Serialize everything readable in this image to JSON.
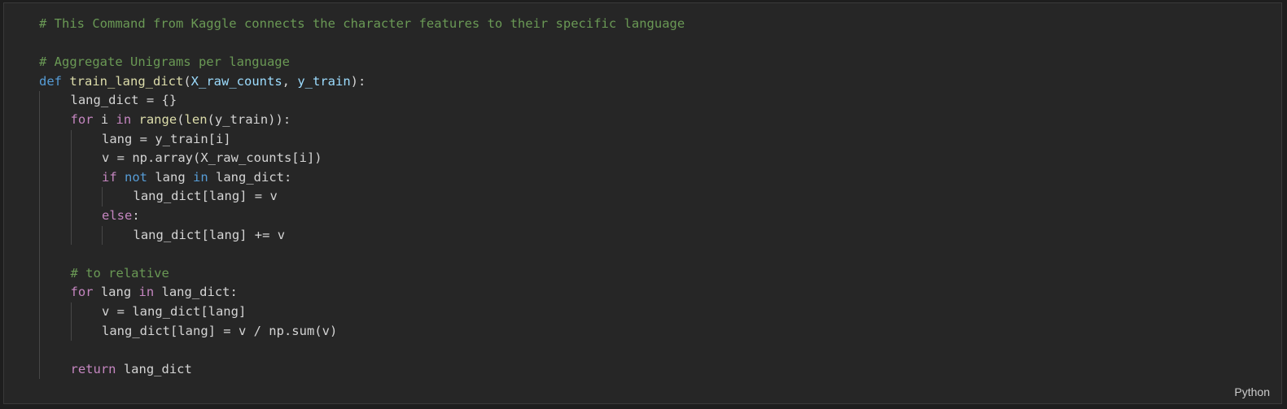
{
  "cell": {
    "language_label": "Python"
  },
  "code_lines": [
    {
      "indent": 0,
      "tokens": [
        {
          "t": "# This Command from Kaggle connects the character features to their specific language",
          "c": "cmt"
        }
      ]
    },
    {
      "indent": 0,
      "tokens": []
    },
    {
      "indent": 0,
      "tokens": [
        {
          "t": "# Aggregate Unigrams per language",
          "c": "cmt"
        }
      ]
    },
    {
      "indent": 0,
      "tokens": [
        {
          "t": "def",
          "c": "kw-def"
        },
        {
          "t": " ",
          "c": "plain"
        },
        {
          "t": "train_lang_dict",
          "c": "fn"
        },
        {
          "t": "(",
          "c": "plain"
        },
        {
          "t": "X_raw_counts",
          "c": "param"
        },
        {
          "t": ", ",
          "c": "plain"
        },
        {
          "t": "y_train",
          "c": "param"
        },
        {
          "t": "):",
          "c": "plain"
        }
      ]
    },
    {
      "indent": 1,
      "tokens": [
        {
          "t": "lang_dict = {}",
          "c": "plain"
        }
      ]
    },
    {
      "indent": 1,
      "tokens": [
        {
          "t": "for",
          "c": "kw-ctl"
        },
        {
          "t": " i ",
          "c": "plain"
        },
        {
          "t": "in",
          "c": "kw-ctl"
        },
        {
          "t": " ",
          "c": "plain"
        },
        {
          "t": "range",
          "c": "fn"
        },
        {
          "t": "(",
          "c": "plain"
        },
        {
          "t": "len",
          "c": "fn"
        },
        {
          "t": "(y_train)):",
          "c": "plain"
        }
      ]
    },
    {
      "indent": 2,
      "tokens": [
        {
          "t": "lang = y_train[i]",
          "c": "plain"
        }
      ]
    },
    {
      "indent": 2,
      "tokens": [
        {
          "t": "v = np.array(X_raw_counts[i])",
          "c": "plain"
        }
      ]
    },
    {
      "indent": 2,
      "tokens": [
        {
          "t": "if",
          "c": "kw-ctl"
        },
        {
          "t": " ",
          "c": "plain"
        },
        {
          "t": "not",
          "c": "kw-op"
        },
        {
          "t": " lang ",
          "c": "plain"
        },
        {
          "t": "in",
          "c": "kw-op"
        },
        {
          "t": " lang_dict:",
          "c": "plain"
        }
      ]
    },
    {
      "indent": 3,
      "tokens": [
        {
          "t": "lang_dict[lang] = v",
          "c": "plain"
        }
      ]
    },
    {
      "indent": 2,
      "tokens": [
        {
          "t": "else",
          "c": "kw-ctl"
        },
        {
          "t": ":",
          "c": "plain"
        }
      ]
    },
    {
      "indent": 3,
      "tokens": [
        {
          "t": "lang_dict[lang] += v",
          "c": "plain"
        }
      ]
    },
    {
      "indent": 1,
      "blank": true,
      "tokens": []
    },
    {
      "indent": 1,
      "tokens": [
        {
          "t": "# to relative",
          "c": "cmt"
        }
      ]
    },
    {
      "indent": 1,
      "tokens": [
        {
          "t": "for",
          "c": "kw-ctl"
        },
        {
          "t": " lang ",
          "c": "plain"
        },
        {
          "t": "in",
          "c": "kw-ctl"
        },
        {
          "t": " lang_dict:",
          "c": "plain"
        }
      ]
    },
    {
      "indent": 2,
      "tokens": [
        {
          "t": "v = lang_dict[lang]",
          "c": "plain"
        }
      ]
    },
    {
      "indent": 2,
      "tokens": [
        {
          "t": "lang_dict[lang] = v / np.sum(v)",
          "c": "plain"
        }
      ]
    },
    {
      "indent": 1,
      "blank": true,
      "tokens": []
    },
    {
      "indent": 1,
      "tokens": [
        {
          "t": "return",
          "c": "kw-ctl"
        },
        {
          "t": " lang_dict",
          "c": "plain"
        }
      ]
    }
  ]
}
